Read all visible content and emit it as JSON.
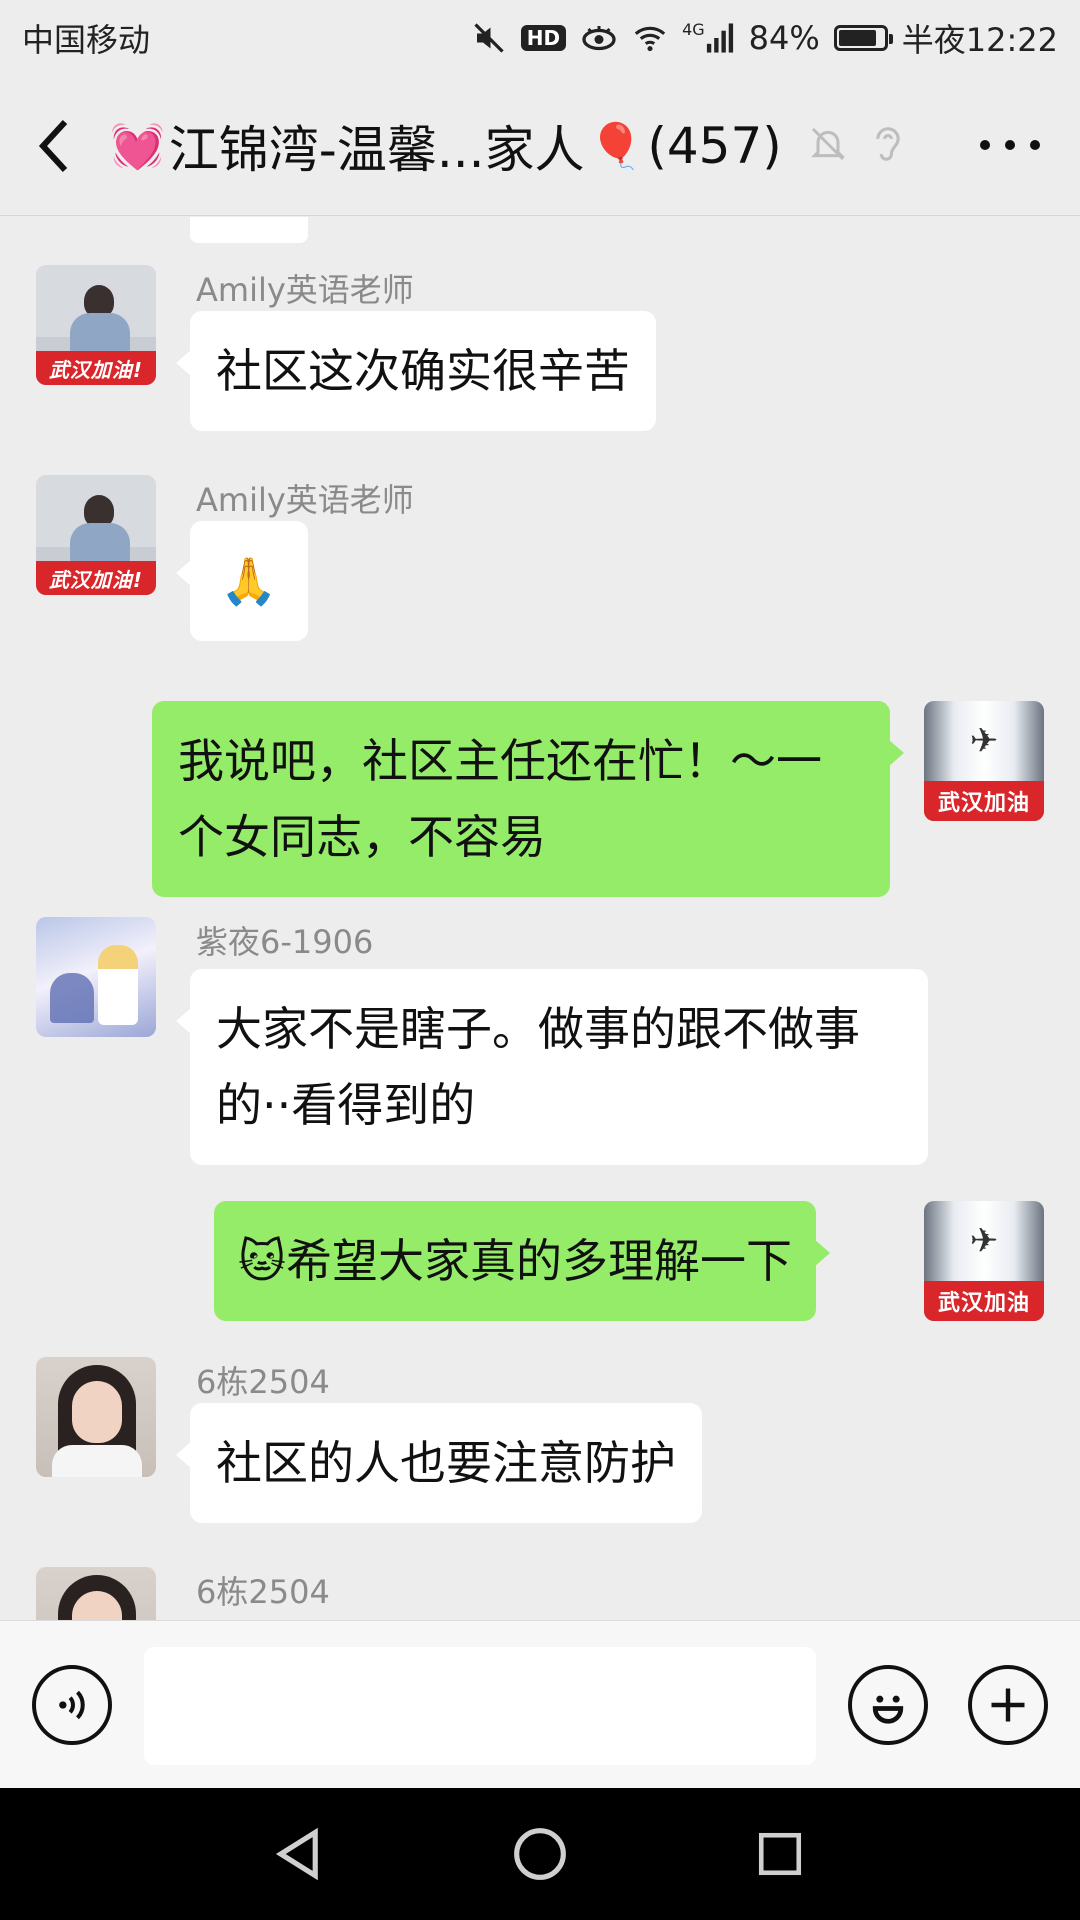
{
  "status_bar": {
    "carrier": "中国移动",
    "network": "4G",
    "battery": "84%",
    "battery_level": 0.84,
    "time": "半夜12:22",
    "icons": [
      "mute-icon",
      "hd-icon",
      "eye-icon",
      "wifi-icon",
      "signal-icon",
      "battery-icon"
    ]
  },
  "header": {
    "title_emoji_left": "💓",
    "title": "江锦湾-温馨...家人",
    "title_emoji_right": "🎈",
    "member_count": "(457)",
    "icons": [
      "back-icon",
      "mute-bell-icon",
      "ear-icon",
      "more-icon"
    ]
  },
  "messages": [
    {
      "sender": "Amily英语老师",
      "text": "社区这次确实很辛苦",
      "avatar_banner": "武汉加油!"
    },
    {
      "sender": "Amily英语老师",
      "text": "🙏",
      "avatar_banner": "武汉加油!"
    },
    {
      "text": "我说吧，社区主任还在忙！～一个女同志，不容易",
      "avatar_banner": "武汉加油"
    },
    {
      "sender": "紫夜6-1906",
      "text": "大家不是瞎子。做事的跟不做事的··看得到的"
    },
    {
      "text": "🐱希望大家真的多理解一下",
      "avatar_banner": "武汉加油"
    },
    {
      "sender": "6栋2504",
      "text": "社区的人也要注意防护"
    },
    {
      "sender": "6栋2504"
    }
  ],
  "input_bar": {
    "value": "",
    "icons": [
      "voice-icon",
      "emoji-icon",
      "plus-icon"
    ]
  },
  "nav_bar": {
    "icons": [
      "nav-back-icon",
      "nav-home-icon",
      "nav-recents-icon"
    ]
  },
  "colors": {
    "background": "#ededed",
    "incoming_bubble": "#ffffff",
    "outgoing_bubble": "#95ec69",
    "avatar_banner": "#d9262b",
    "sender_name": "#8a8a8a"
  }
}
